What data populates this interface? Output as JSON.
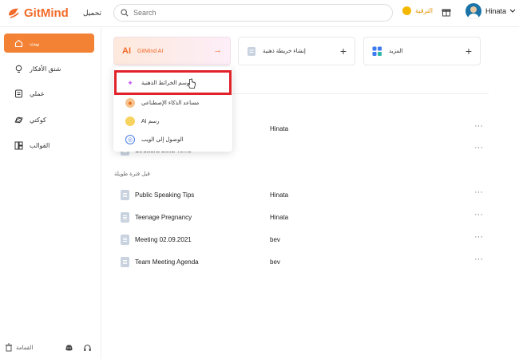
{
  "header": {
    "brand": "GitMind",
    "download": "تحميل",
    "search_placeholder": "Search",
    "upgrade": "الترقية",
    "user_name": "Hinata"
  },
  "sidebar": {
    "items": [
      {
        "label": "بيت"
      },
      {
        "label": "شتق الأفكار"
      },
      {
        "label": "عملي"
      },
      {
        "label": "كوكتي"
      },
      {
        "label": "القوالب"
      }
    ],
    "trash": "القمامة"
  },
  "cards": {
    "ai": {
      "badge": "AI",
      "label": "GitMind AI"
    },
    "create_mindmap": {
      "label": "إنشاء خريطة ذهنية"
    },
    "more": {
      "label": "المزيد"
    }
  },
  "dropdown": {
    "items": [
      {
        "label": "رسم الخرائط الذهنية"
      },
      {
        "label": "مساعد الذكاء الإصطناعي"
      },
      {
        "label": "AI رسم"
      },
      {
        "label": "الوصول إلى الويب"
      }
    ]
  },
  "files": {
    "group1_rows": [
      {
        "name": "",
        "owner": "Hinata"
      },
      {
        "name": "Struttura della Terra",
        "owner": ""
      }
    ],
    "group2_label": "قبل فترة طويلة",
    "group2_rows": [
      {
        "name": "Public Speaking Tips",
        "owner": "Hinata"
      },
      {
        "name": "Teenage Pregnancy",
        "owner": "Hinata"
      },
      {
        "name": "Meeting 02.09.2021",
        "owner": "bev"
      },
      {
        "name": "Team Meeting Agenda",
        "owner": "bev"
      }
    ],
    "more_glyph": "···"
  },
  "colors": {
    "accent": "#f48234",
    "highlight": "#e0232a"
  }
}
